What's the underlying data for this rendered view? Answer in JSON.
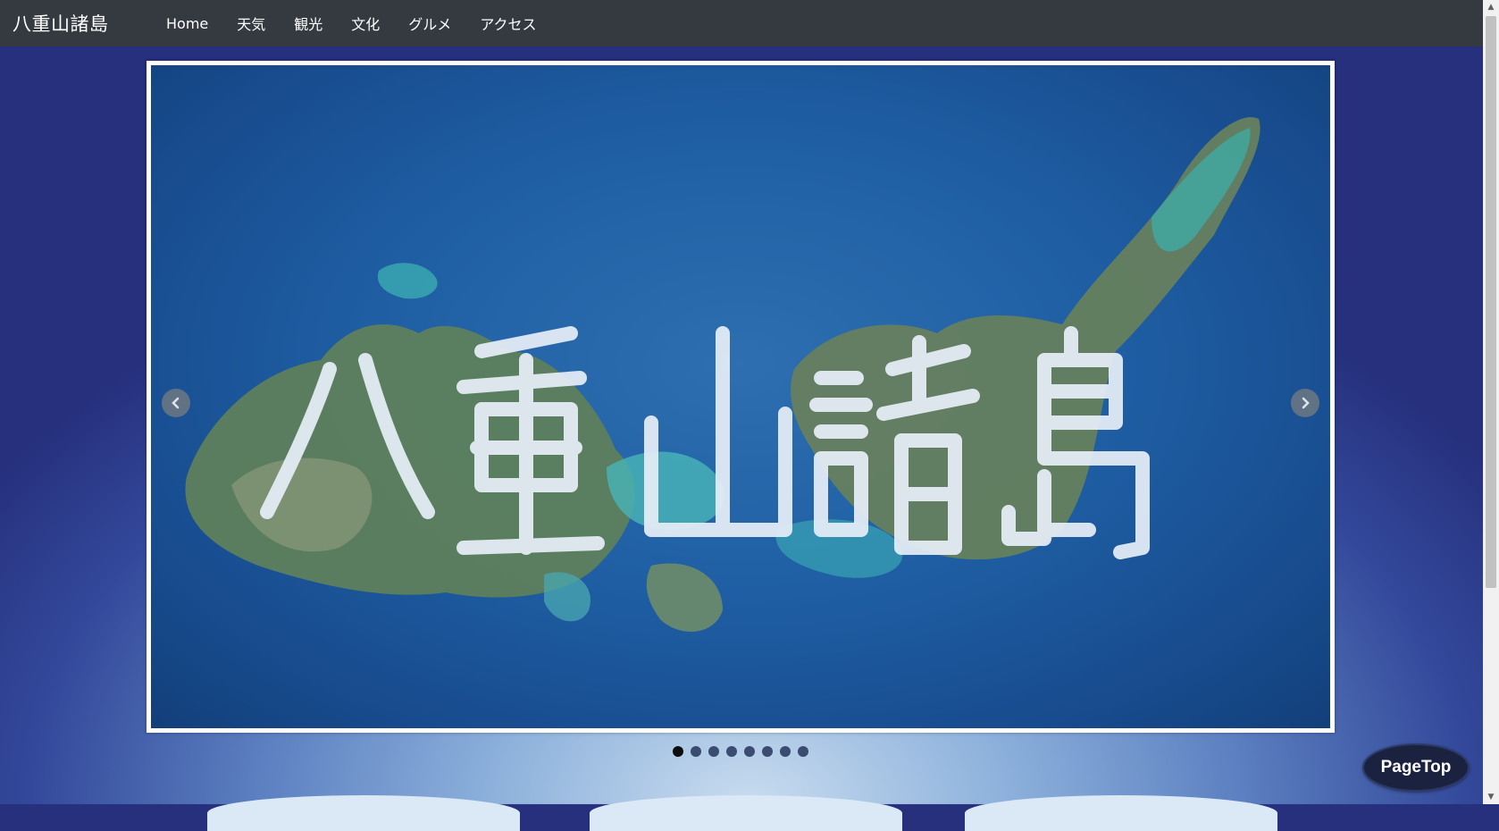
{
  "navbar": {
    "brand": "八重山諸島",
    "links": [
      "Home",
      "天気",
      "観光",
      "文化",
      "グルメ",
      "アクセス"
    ]
  },
  "carousel": {
    "slide_title_art": "八重山諸島",
    "prev_icon": "chevron-left-icon",
    "next_icon": "chevron-right-icon",
    "indicator_count": 8,
    "active_index": 0
  },
  "pagetop": {
    "label": "PageTop"
  },
  "colors": {
    "navbar_bg": "#343a40",
    "sea": "#1f5ea3",
    "pagetop_bg": "#1a2240"
  }
}
